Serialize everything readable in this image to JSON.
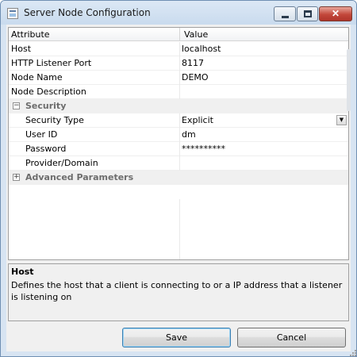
{
  "window": {
    "title": "Server Node Configuration",
    "close_glyph": "✕"
  },
  "grid": {
    "headers": {
      "attribute": "Attribute",
      "value": "Value"
    },
    "rows": [
      {
        "attribute": "Host",
        "value": "localhost"
      },
      {
        "attribute": "HTTP Listener Port",
        "value": "8117"
      },
      {
        "attribute": "Node Name",
        "value": "DEMO"
      },
      {
        "attribute": "Node Description",
        "value": ""
      }
    ],
    "security": {
      "label": "Security",
      "expander": "−",
      "rows": [
        {
          "attribute": "Security Type",
          "value": "Explicit"
        },
        {
          "attribute": "User ID",
          "value": "dm"
        },
        {
          "attribute": "Password",
          "value": "**********"
        },
        {
          "attribute": "Provider/Domain",
          "value": ""
        }
      ]
    },
    "advanced": {
      "label": "Advanced Parameters",
      "expander": "+"
    }
  },
  "description": {
    "title": "Host",
    "text": "Defines the host that a client is connecting to or a IP address that a listener is listening on"
  },
  "buttons": {
    "save": "Save",
    "cancel": "Cancel"
  },
  "icons": {
    "window": "window-icon",
    "minimize": "minimize-icon",
    "maximize": "maximize-icon",
    "close": "close-icon",
    "dropdown": "chevron-down-icon",
    "collapse": "collapse-icon",
    "expand": "expand-icon"
  },
  "colors": {
    "title_bar": "#c9dbee",
    "close_button": "#c2473a",
    "default_button_border": "#3c7fb1"
  }
}
